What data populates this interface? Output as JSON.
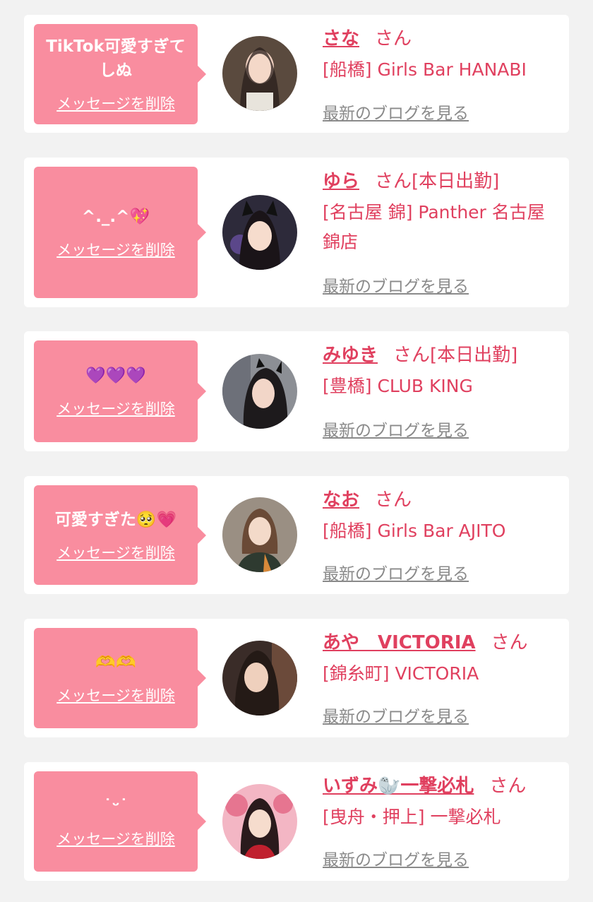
{
  "colors": {
    "background": "#f2f2f2",
    "card": "#ffffff",
    "bubble": "#f98d9f",
    "accent": "#e0405f",
    "muted": "#8a8a8a"
  },
  "labels": {
    "delete_message": "メッセージを削除",
    "san": "さん",
    "latest_blog": "最新のブログを見る"
  },
  "messages": [
    {
      "message": "TikTok可愛すぎてしぬ",
      "name": "さな",
      "status": "",
      "shop": "[船橋] Girls Bar HANABI",
      "avatar_icon": "profile-photo"
    },
    {
      "message": "^._.^💖",
      "name": "ゆら",
      "status": "[本日出勤]",
      "shop": "[名古屋 錦] Panther 名古屋錦店",
      "avatar_icon": "profile-photo"
    },
    {
      "message": "💜💜💜",
      "name": "みゆき",
      "status": "[本日出勤]",
      "shop": "[豊橋] CLUB KING",
      "avatar_icon": "profile-photo"
    },
    {
      "message": "可愛すぎた🥺💗",
      "name": "なお",
      "status": "",
      "shop": "[船橋] Girls Bar AJITO",
      "avatar_icon": "profile-photo"
    },
    {
      "message": "🫶🫶",
      "name": "あや　VICTORIA",
      "status": "",
      "shop": "[錦糸町] VICTORIA",
      "avatar_icon": "profile-photo"
    },
    {
      "message": "˙ᵕ˙",
      "name": "いずみ🦭一撃必札",
      "status": "",
      "shop": "[曳舟・押上] 一撃必札",
      "avatar_icon": "profile-photo"
    }
  ]
}
